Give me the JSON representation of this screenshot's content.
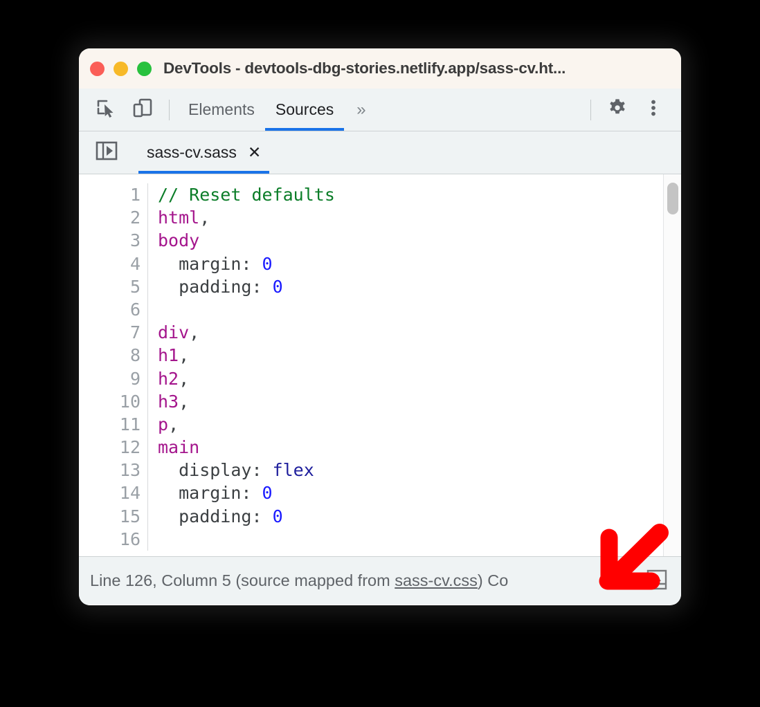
{
  "window": {
    "title": "DevTools - devtools-dbg-stories.netlify.app/sass-cv.ht...",
    "traffic_lights": [
      {
        "name": "close",
        "color": "#fa5e57"
      },
      {
        "name": "minimize",
        "color": "#f7b928"
      },
      {
        "name": "maximize",
        "color": "#28c13e"
      }
    ],
    "titlebar_bg": "#faf5ef"
  },
  "toolbar": {
    "inspect_icon": "inspect-element-icon",
    "device_icon": "device-toolbar-icon",
    "tabs": [
      {
        "label": "Elements",
        "active": false
      },
      {
        "label": "Sources",
        "active": true
      }
    ],
    "more_tabs": "»",
    "settings_icon": "gear-icon",
    "menu_icon": "kebab-menu-icon",
    "accent_color": "#1a73e8"
  },
  "tabstrip": {
    "navigator_toggle_icon": "show-navigator-icon",
    "file_tab": {
      "name": "sass-cv.sass",
      "close_label": "✕",
      "active": true
    }
  },
  "editor": {
    "lines": [
      {
        "num": "1",
        "tokens": [
          {
            "t": "// Reset defaults",
            "c": "tok-comment"
          }
        ]
      },
      {
        "num": "2",
        "tokens": [
          {
            "t": "html",
            "c": "tok-selector"
          },
          {
            "t": ",",
            "c": "tok-punc"
          }
        ]
      },
      {
        "num": "3",
        "tokens": [
          {
            "t": "body",
            "c": "tok-selector"
          }
        ]
      },
      {
        "num": "4",
        "tokens": [
          {
            "t": "  margin: ",
            "c": "tok-prop"
          },
          {
            "t": "0",
            "c": "tok-num"
          }
        ]
      },
      {
        "num": "5",
        "tokens": [
          {
            "t": "  padding: ",
            "c": "tok-prop"
          },
          {
            "t": "0",
            "c": "tok-num"
          }
        ]
      },
      {
        "num": "6",
        "tokens": [
          {
            "t": "",
            "c": "tok-prop"
          }
        ]
      },
      {
        "num": "7",
        "tokens": [
          {
            "t": "div",
            "c": "tok-selector"
          },
          {
            "t": ",",
            "c": "tok-punc"
          }
        ]
      },
      {
        "num": "8",
        "tokens": [
          {
            "t": "h1",
            "c": "tok-selector"
          },
          {
            "t": ",",
            "c": "tok-punc"
          }
        ]
      },
      {
        "num": "9",
        "tokens": [
          {
            "t": "h2",
            "c": "tok-selector"
          },
          {
            "t": ",",
            "c": "tok-punc"
          }
        ]
      },
      {
        "num": "10",
        "tokens": [
          {
            "t": "h3",
            "c": "tok-selector"
          },
          {
            "t": ",",
            "c": "tok-punc"
          }
        ]
      },
      {
        "num": "11",
        "tokens": [
          {
            "t": "p",
            "c": "tok-selector"
          },
          {
            "t": ",",
            "c": "tok-punc"
          }
        ]
      },
      {
        "num": "12",
        "tokens": [
          {
            "t": "main",
            "c": "tok-selector"
          }
        ]
      },
      {
        "num": "13",
        "tokens": [
          {
            "t": "  display: ",
            "c": "tok-prop"
          },
          {
            "t": "flex",
            "c": "tok-value"
          }
        ]
      },
      {
        "num": "14",
        "tokens": [
          {
            "t": "  margin: ",
            "c": "tok-prop"
          },
          {
            "t": "0",
            "c": "tok-num"
          }
        ]
      },
      {
        "num": "15",
        "tokens": [
          {
            "t": "  padding: ",
            "c": "tok-prop"
          },
          {
            "t": "0",
            "c": "tok-num"
          }
        ]
      },
      {
        "num": "16",
        "tokens": [
          {
            "t": "",
            "c": "tok-prop"
          }
        ]
      }
    ],
    "scrollbar": {
      "name": "vertical-scrollbar"
    }
  },
  "statusbar": {
    "prefix": "Line 126, Column 5  (source mapped from ",
    "link": "sass-cv.css",
    "suffix": ") Co",
    "format_button_icon": "pretty-print-icon"
  },
  "annotation": {
    "arrow_color": "#ff0000",
    "arrow_name": "callout-arrow-down-left"
  }
}
